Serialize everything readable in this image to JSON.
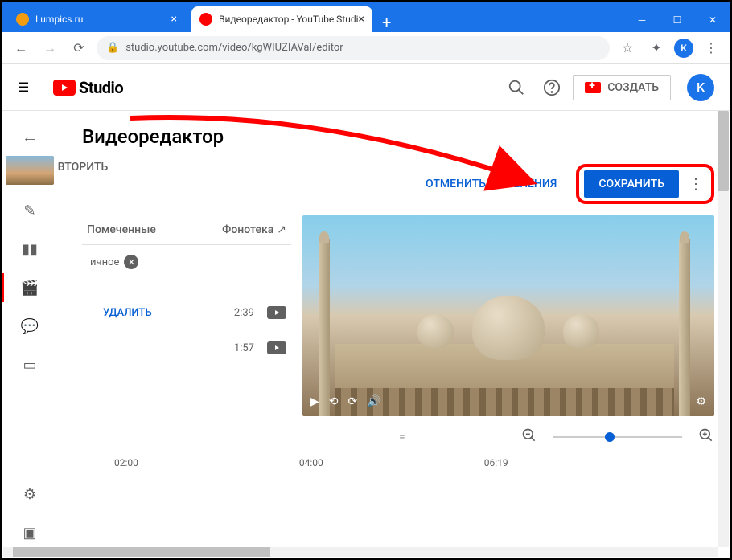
{
  "browser": {
    "tabs": [
      {
        "title": "Lumpics.ru"
      },
      {
        "title": "Видеоредактор - YouTube Studi"
      }
    ],
    "url": "studio.youtube.com/video/kgWIUZIAVaI/editor"
  },
  "header": {
    "logo": "Studio",
    "create": "СОЗДАТЬ",
    "avatar": "K"
  },
  "page": {
    "title": "Видеоредактор",
    "replay": "ОВТОРИТЬ",
    "discard": "ОТМЕНИТЬ ИЗМЕНЕНИЯ",
    "save": "СОХРАНИТЬ"
  },
  "tabs": {
    "marked": "Помеченные",
    "library": "Фонотека"
  },
  "chip": {
    "label": "ичное"
  },
  "tracks": [
    {
      "delete": "УДАЛИТЬ",
      "duration": "2:39"
    },
    {
      "duration": "1:57"
    }
  ],
  "timeline": {
    "marks": [
      "02:00",
      "04:00",
      "06:19"
    ]
  },
  "drag": "="
}
